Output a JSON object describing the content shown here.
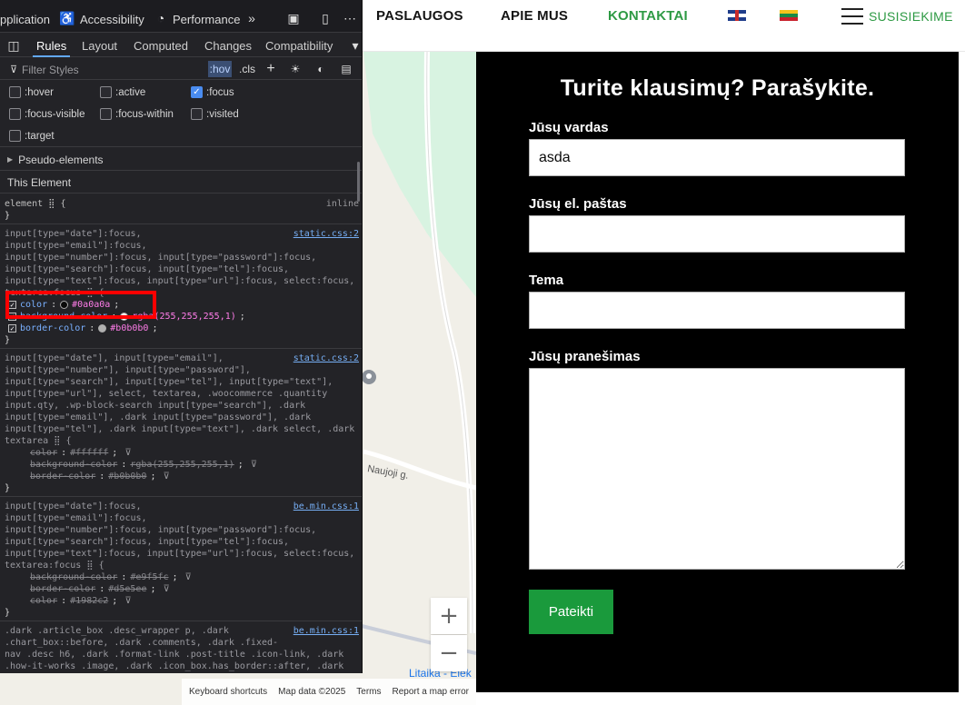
{
  "website": {
    "nav": {
      "items": [
        "PASLAUGOS",
        "APIE MUS",
        "KONTAKTAI"
      ],
      "active": "KONTAKTAI",
      "contact_cta": "SUSISIEKIME"
    },
    "map": {
      "street_label": "Naujoji g.",
      "place_label": "Litaika - Elek",
      "zoom_in": "+",
      "zoom_out": "−",
      "footer": {
        "shortcuts": "Keyboard shortcuts",
        "map_data": "Map data ©2025",
        "terms": "Terms",
        "report": "Report a map error"
      }
    },
    "form": {
      "title": "Turite klausimų? Parašykite.",
      "name_label": "Jūsų vardas",
      "name_value": "asda",
      "email_label": "Jūsų el. paštas",
      "subject_label": "Tema",
      "message_label": "Jūsų pranešimas",
      "submit": "Pateikti"
    },
    "colors": {
      "accent_green": "#1a9a3c",
      "panel_bg": "#000000"
    }
  },
  "devtools": {
    "top_tabs": [
      "pplication",
      "Accessibility",
      "Performance"
    ],
    "sub_tabs": [
      "Rules",
      "Layout",
      "Computed",
      "Changes",
      "Compatibility"
    ],
    "active_sub_tab": "Rules",
    "filter_placeholder": "Filter Styles",
    "hov_label": ":hov",
    "cls_label": ".cls",
    "pseudo_classes": [
      {
        "label": ":hover",
        "checked": false
      },
      {
        "label": ":active",
        "checked": false
      },
      {
        "label": ":focus",
        "checked": true
      },
      {
        "label": ":focus-visible",
        "checked": false
      },
      {
        "label": ":focus-within",
        "checked": false
      },
      {
        "label": ":visited",
        "checked": false
      },
      {
        "label": ":target",
        "checked": false
      }
    ],
    "pseudo_elements_label": "Pseudo-elements",
    "this_element_label": "This Element",
    "rules": [
      {
        "selector_html": "element ⣿ {",
        "source": "inline",
        "source_link": false,
        "declarations": [],
        "close": "}"
      },
      {
        "selector_lines": [
          "input[type=\"date\"]:focus,",
          "input[type=\"email\"]:focus,",
          "input[type=\"number\"]:focus, input[type=\"password\"]:focus,",
          "input[type=\"search\"]:focus, input[type=\"tel\"]:focus,",
          "input[type=\"text\"]:focus, input[type=\"url\"]:focus, select:focus,",
          "textarea:focus ⣿ {"
        ],
        "source": "static.css:2",
        "source_link": true,
        "declarations": [
          {
            "prop": "color",
            "value": "#0a0a0a",
            "swatch": "#0a0a0a",
            "enabled": true,
            "off": false
          },
          {
            "prop": "background-color",
            "value": "rgba(255,255,255,1)",
            "swatch": "#ffffff",
            "enabled": true,
            "off": false
          },
          {
            "prop": "border-color",
            "value": "#b0b0b0",
            "swatch": "#b0b0b0",
            "enabled": true,
            "off": false
          }
        ],
        "close": "}"
      },
      {
        "selector_lines": [
          "input[type=\"date\"], input[type=\"email\"],",
          "input[type=\"number\"], input[type=\"password\"],",
          "input[type=\"search\"], input[type=\"tel\"], input[type=\"text\"],",
          "input[type=\"url\"], select, textarea, .woocommerce .quantity",
          "input.qty, .wp-block-search input[type=\"search\"], .dark",
          "input[type=\"email\"], .dark input[type=\"password\"], .dark",
          "input[type=\"tel\"], .dark input[type=\"text\"], .dark select, .dark",
          "textarea ⣿ {"
        ],
        "source": "static.css:2",
        "source_link": true,
        "declarations": [
          {
            "prop": "color",
            "value": "#ffffff",
            "swatch": "",
            "enabled": false,
            "off": true
          },
          {
            "prop": "background-color",
            "value": "rgba(255,255,255,1)",
            "swatch": "",
            "enabled": false,
            "off": true
          },
          {
            "prop": "border-color",
            "value": "#b0b0b0",
            "swatch": "",
            "enabled": false,
            "off": true
          }
        ],
        "close": "}"
      },
      {
        "selector_lines": [
          "input[type=\"date\"]:focus,",
          "input[type=\"email\"]:focus,",
          "input[type=\"number\"]:focus, input[type=\"password\"]:focus,",
          "input[type=\"search\"]:focus, input[type=\"tel\"]:focus,",
          "input[type=\"text\"]:focus, input[type=\"url\"]:focus, select:focus,",
          "textarea:focus ⣿ {"
        ],
        "source": "be.min.css:1",
        "source_link": true,
        "declarations": [
          {
            "prop": "background-color",
            "value": "#e9f5fc",
            "swatch": "",
            "enabled": false,
            "off": true
          },
          {
            "prop": "border-color",
            "value": "#d5e5ee",
            "swatch": "",
            "enabled": false,
            "off": true
          },
          {
            "prop": "color",
            "value": "#1982c2",
            "swatch": "",
            "enabled": false,
            "off": true
          }
        ],
        "close": "}"
      },
      {
        "selector_lines": [
          ".dark .article_box .desc_wrapper p, .dark",
          ".chart_box::before, .dark .comments, .dark .fixed-",
          "nav .desc h6, .dark .format-link .post-title .icon-link, .dark",
          ".how-it-works .image, .dark .icon_box.has_border::after, .dark"
        ],
        "source": "be.min.css:1",
        "source_link": true,
        "declarations": [],
        "close": ""
      }
    ]
  }
}
